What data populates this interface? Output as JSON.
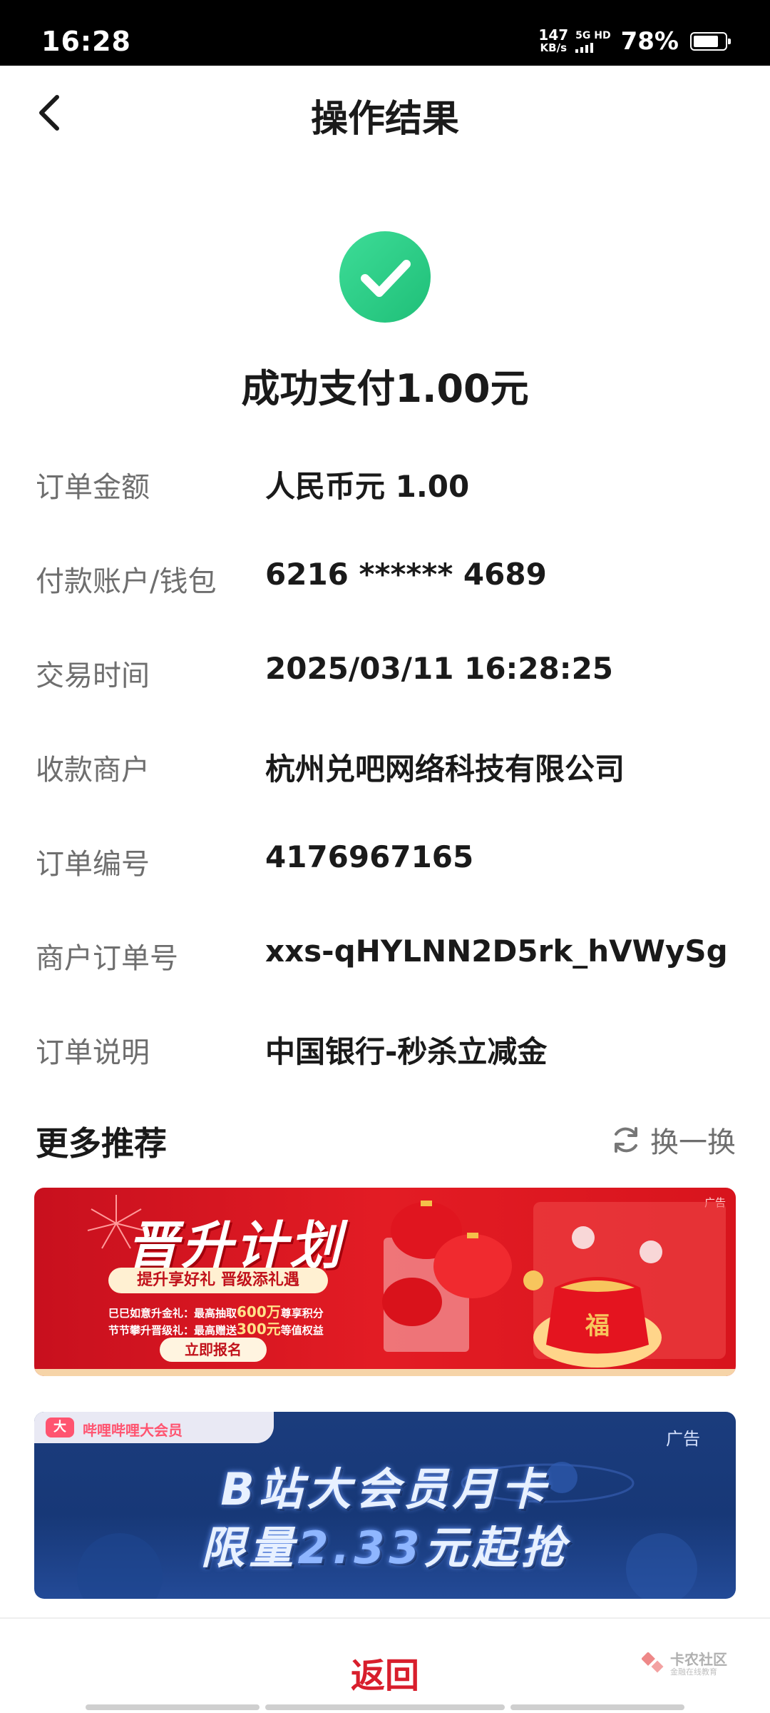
{
  "status_bar": {
    "time": "16:28",
    "net_speed_value": "147",
    "net_speed_unit": "KB/s",
    "network": "5G HD",
    "battery": "78%",
    "battery_level": 0.78
  },
  "nav": {
    "title": "操作结果"
  },
  "result": {
    "message": "成功支付1.00元"
  },
  "details": [
    {
      "label": "订单金额",
      "value": "人民币元 1.00"
    },
    {
      "label": "付款账户/钱包",
      "value": "6216 ****** 4689"
    },
    {
      "label": "交易时间",
      "value": "2025/03/11 16:28:25"
    },
    {
      "label": "收款商户",
      "value": "杭州兑吧网络科技有限公司"
    },
    {
      "label": "订单编号",
      "value": "4176967165"
    },
    {
      "label": "商户订单号",
      "value": "xxs-qHYLNN2D5rk_hVWySg"
    },
    {
      "label": "订单说明",
      "value": "中国银行-秒杀立减金"
    }
  ],
  "more": {
    "title": "更多推荐",
    "refresh_label": "换一换"
  },
  "banner1": {
    "ad_label": "广告",
    "title": "晋升计划",
    "pill": "提升享好礼 晋级添礼遇",
    "line1_prefix": "巳巳如意升金礼：最高抽取",
    "line1_highlight": "600万",
    "line1_suffix": "尊享积分",
    "line2_prefix": "节节攀升晋级礼：最高赠送",
    "line2_highlight": "300元",
    "line2_suffix": "等值权益",
    "cta": "立即报名",
    "bag_char": "福"
  },
  "banner2": {
    "ad_label": "广告",
    "logo": "大",
    "tab_text": "哔哩哔哩大会员",
    "line1": "B站大会员月卡",
    "line2_prefix": "限量",
    "line2_number": "2.33",
    "line2_suffix": "元起抢"
  },
  "bottom": {
    "return_label": "返回",
    "watermark_title": "卡农社区",
    "watermark_sub": "金融在线教育"
  },
  "colors": {
    "success_green": "#2ecf87",
    "return_red": "#d81e2c",
    "banner1_red": "#e31c24",
    "banner2_blue": "#173877"
  }
}
